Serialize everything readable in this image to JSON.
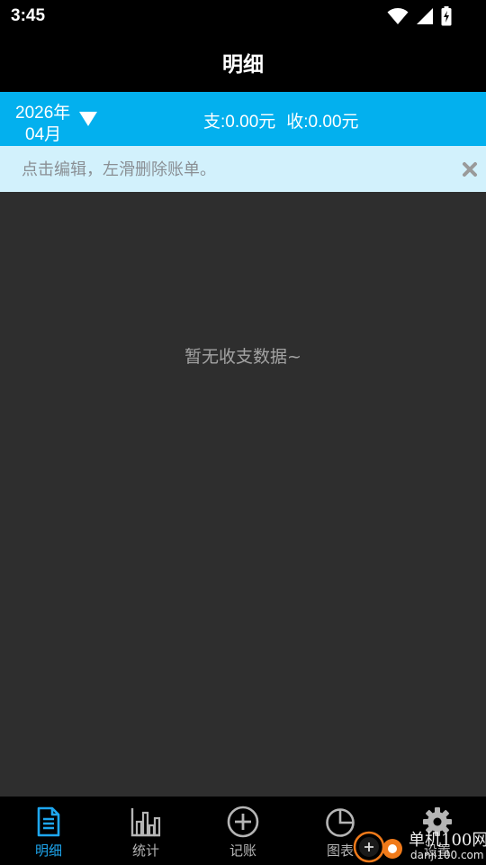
{
  "status_bar": {
    "time": "3:45"
  },
  "header": {
    "title": "明细"
  },
  "summary": {
    "year": "2026年",
    "month": "04月",
    "expense": "支:0.00元",
    "income": "收:0.00元"
  },
  "tip": {
    "text": "点击编辑，左滑删除账单。"
  },
  "content": {
    "empty_text": "暂无收支数据~"
  },
  "bottom_nav": {
    "items": [
      {
        "label": "明细",
        "icon": "list-document-icon",
        "active": true
      },
      {
        "label": "统计",
        "icon": "bar-chart-icon",
        "active": false
      },
      {
        "label": "记账",
        "icon": "plus-circle-icon",
        "active": false
      },
      {
        "label": "图表",
        "icon": "pie-chart-icon",
        "active": false
      },
      {
        "label": "设置",
        "icon": "gear-icon",
        "active": false
      }
    ]
  },
  "watermark": {
    "name": "单机100网",
    "url": "danji100.com"
  },
  "colors": {
    "accent": "#03b0ee",
    "active_nav": "#1ea7f0",
    "tip_background": "#d2f1fc",
    "content_background": "#2e2e2e",
    "bar_background": "#000000"
  }
}
